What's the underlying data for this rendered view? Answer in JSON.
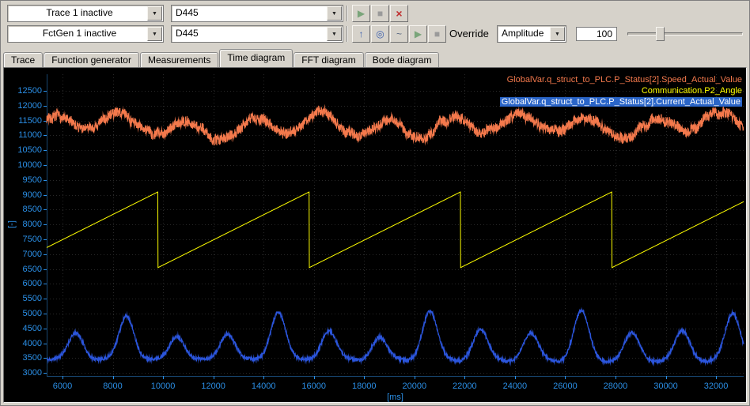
{
  "icons": {
    "chevron_down": "▼"
  },
  "toolbar": {
    "row1": {
      "channel_combo": "Trace 1 inactive",
      "device_combo": "D445",
      "buttons": [
        {
          "name": "start-trace",
          "icon": "play-icon",
          "glyph": "▶",
          "color": "#7aa57a"
        },
        {
          "name": "stop-trace",
          "icon": "stop-icon",
          "glyph": "■",
          "color": "#9a9a9a"
        },
        {
          "name": "reset-trace",
          "icon": "red-cross-icon",
          "glyph": "×",
          "color": "#c03030"
        }
      ]
    },
    "row2": {
      "channel_combo": "FctGen 1 inactive",
      "device_combo": "D445",
      "buttons": [
        {
          "name": "takeover-values",
          "icon": "up-arrow-icon",
          "glyph": "↑",
          "color": "#3a5fae"
        },
        {
          "name": "trigger-settings",
          "icon": "target-icon",
          "glyph": "◎",
          "color": "#3a5fae"
        },
        {
          "name": "signal-shape",
          "icon": "wave-icon",
          "glyph": "~",
          "color": "#55657f"
        },
        {
          "name": "start-fctgen",
          "icon": "play-icon",
          "glyph": "▶",
          "color": "#7aa57a"
        },
        {
          "name": "stop-fctgen",
          "icon": "stop-icon",
          "glyph": "■",
          "color": "#9a9a9a"
        }
      ],
      "override_label": "Override",
      "override_param": "Amplitude",
      "override_value": "100"
    }
  },
  "tabs": [
    {
      "label": "Trace",
      "active": false
    },
    {
      "label": "Function generator",
      "active": false
    },
    {
      "label": "Measurements",
      "active": false
    },
    {
      "label": "Time diagram",
      "active": true
    },
    {
      "label": "FFT diagram",
      "active": false
    },
    {
      "label": "Bode diagram",
      "active": false
    }
  ],
  "chart_data": {
    "type": "line",
    "xlabel": "[ms]",
    "ylabel": "[-]",
    "xlim": [
      5370,
      33100
    ],
    "ylim": [
      2900,
      13060
    ],
    "x_ticks": [
      6000,
      8000,
      10000,
      12000,
      14000,
      16000,
      18000,
      20000,
      22000,
      24000,
      26000,
      28000,
      30000,
      32000
    ],
    "y_ticks": [
      12500,
      12000,
      11500,
      11000,
      10500,
      10000,
      9500,
      9000,
      8500,
      8000,
      7500,
      7000,
      6500,
      6000,
      5500,
      5000,
      4500,
      4000,
      3500,
      3000
    ],
    "background": "#000000",
    "axis_color": "#2b8fe6",
    "grid_color": "#282828",
    "grid": "dotted",
    "legend_position": "top-right",
    "series": [
      {
        "label": "GlobalVar.q_struct_to_PLC.P_Status[2].Speed_Actual_Value",
        "color": "#f4794c",
        "type": "noisy",
        "width": 1,
        "baseline": 11350,
        "slow_amp": 300,
        "slow_period": 2650,
        "second_amp": 150,
        "second_period": 8200,
        "walk_step": 55,
        "noise": 170,
        "min": 10580,
        "max": 12430,
        "seed": 7
      },
      {
        "label": "Communication.P2_Angle",
        "color": "#ffff00",
        "type": "sawtooth",
        "width": 1,
        "min": 6550,
        "max": 9100,
        "period": 6020,
        "reset_at": 9800
      },
      {
        "label": "GlobalVar.q_struct_to_PLC.P_Status[2].Current_Actual_Value",
        "color": "#2b55dc",
        "type": "bumps",
        "width": 1.2,
        "baseline": 3430,
        "bump_period": 2010,
        "tall_center": 8550,
        "tall_every": 3,
        "tall_height": 1570,
        "short_height": 900,
        "sigma": 300,
        "noise": 55,
        "seed": 11,
        "selected": true,
        "selection_bg": "#2a65c8",
        "selection_fg": "#ffffff"
      }
    ]
  }
}
